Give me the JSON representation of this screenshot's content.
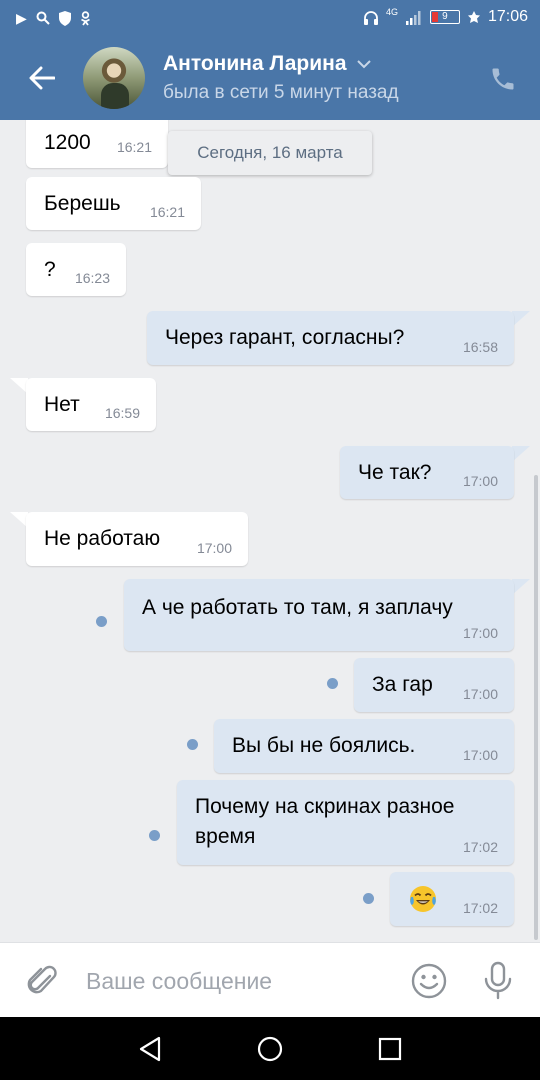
{
  "status_bar": {
    "left_icons": [
      "play-icon",
      "search-icon",
      "shield-icon",
      "ok-icon"
    ],
    "network": "4G",
    "battery_percent": "9",
    "time": "17:06"
  },
  "header": {
    "name": "Антонина Ларина",
    "status": "была в сети 5 минут назад",
    "back_icon": "arrow-left-icon",
    "call_icon": "phone-icon"
  },
  "date_separator": "Сегодня, 16 марта",
  "messages": [
    {
      "dir": "in",
      "text": "1200",
      "time": "16:21",
      "unread": false
    },
    {
      "dir": "in",
      "text": "Берешь",
      "time": "16:21",
      "unread": false
    },
    {
      "dir": "in",
      "text": "?",
      "time": "16:23",
      "unread": false
    },
    {
      "dir": "out",
      "text": "Через гарант, согласны?",
      "time": "16:58",
      "unread": false
    },
    {
      "dir": "in",
      "text": "Нет",
      "time": "16:59",
      "unread": false
    },
    {
      "dir": "out",
      "text": "Че так?",
      "time": "17:00",
      "unread": false
    },
    {
      "dir": "in",
      "text": "Не работаю",
      "time": "17:00",
      "unread": false
    },
    {
      "dir": "out",
      "text": "А че работать то там, я заплачу",
      "time": "17:00",
      "unread": true
    },
    {
      "dir": "out",
      "text": "За гар",
      "time": "17:00",
      "unread": true
    },
    {
      "dir": "out",
      "text": "Вы бы не боялись.",
      "time": "17:00",
      "unread": true
    },
    {
      "dir": "out",
      "text": "Почему на скринах разное\nвремя",
      "time": "17:02",
      "unread": true
    },
    {
      "dir": "out",
      "text": "",
      "emoji": "face-with-tears-of-joy",
      "time": "17:02",
      "unread": true
    }
  ],
  "composer": {
    "placeholder": "Ваше сообщение",
    "attach_icon": "paperclip-icon",
    "emoji_icon": "smiley-icon",
    "mic_icon": "microphone-icon"
  },
  "navbar": [
    "back-triangle-icon",
    "home-circle-icon",
    "recents-square-icon"
  ],
  "colors": {
    "accent": "#4a76a8",
    "chat_bg": "#edeef0",
    "outgoing_bubble": "#dce6f2",
    "incoming_bubble": "#ffffff",
    "unread_dot": "#7a9ec8"
  }
}
